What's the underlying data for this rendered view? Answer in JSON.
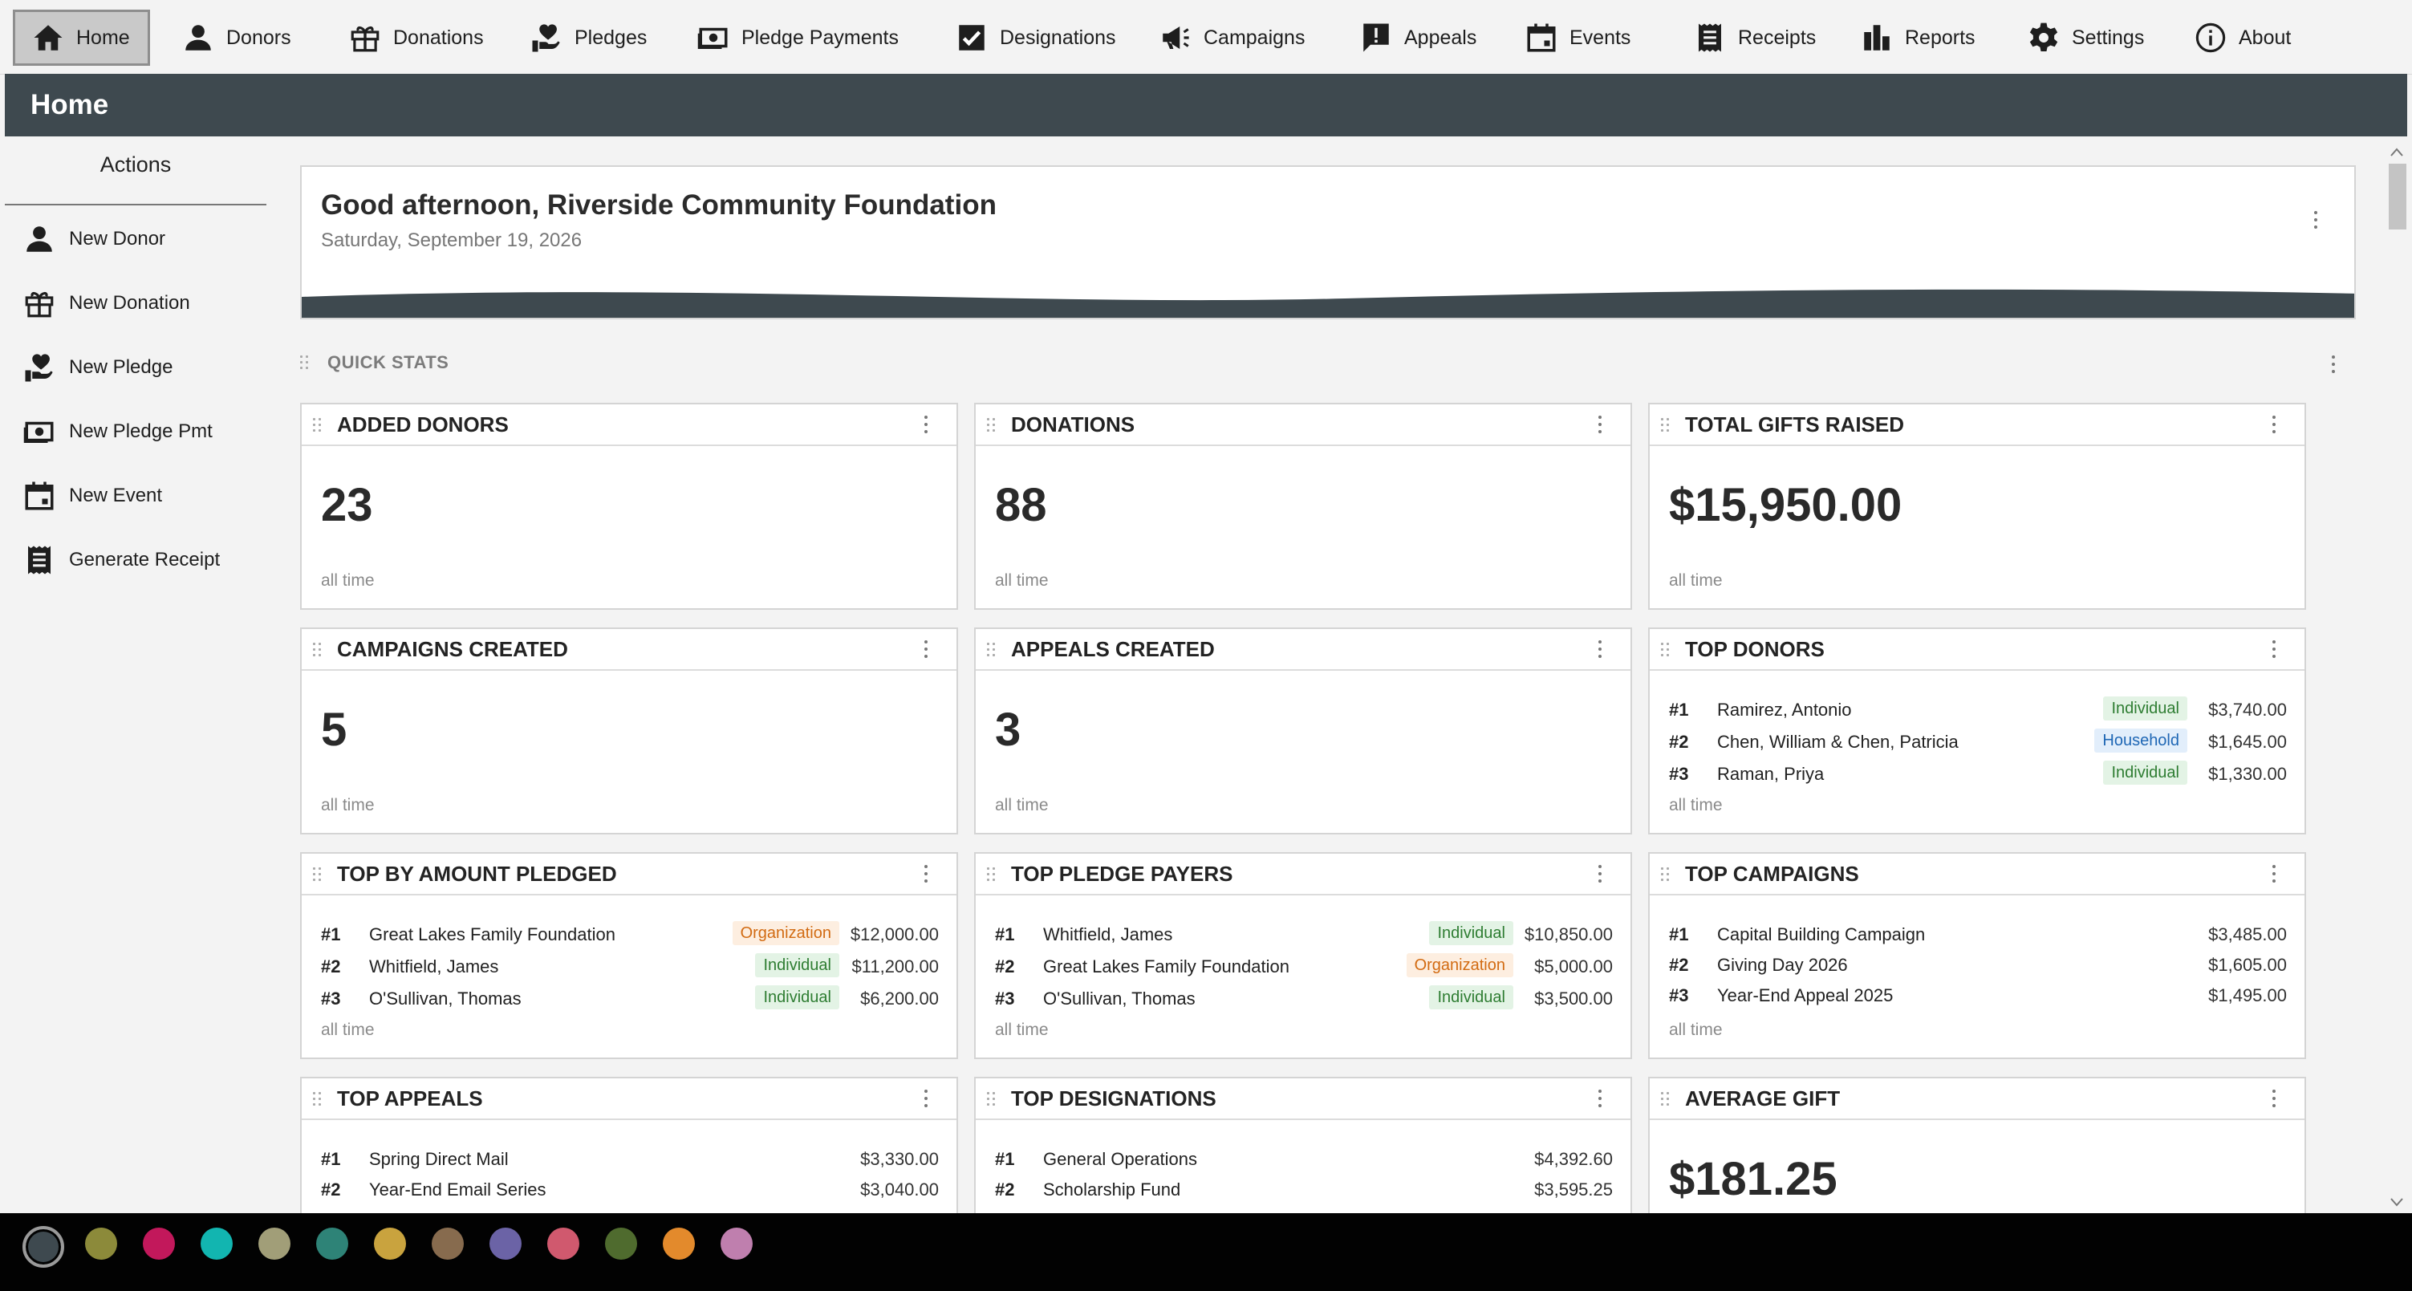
{
  "nav": {
    "items": [
      {
        "label": "Home",
        "icon": "home-icon"
      },
      {
        "label": "Donors",
        "icon": "person-icon"
      },
      {
        "label": "Donations",
        "icon": "gift-icon"
      },
      {
        "label": "Pledges",
        "icon": "hand-heart-icon"
      },
      {
        "label": "Pledge Payments",
        "icon": "cash-icon"
      },
      {
        "label": "Designations",
        "icon": "checkbox-icon"
      },
      {
        "label": "Campaigns",
        "icon": "megaphone-icon"
      },
      {
        "label": "Appeals",
        "icon": "alert-bubble-icon"
      },
      {
        "label": "Events",
        "icon": "calendar-icon"
      },
      {
        "label": "Receipts",
        "icon": "receipt-icon"
      },
      {
        "label": "Reports",
        "icon": "bar-chart-icon"
      },
      {
        "label": "Settings",
        "icon": "gear-icon"
      },
      {
        "label": "About",
        "icon": "info-icon"
      }
    ],
    "active": "Home"
  },
  "header": {
    "title": "Home"
  },
  "sidebar": {
    "title": "Actions",
    "items": [
      {
        "label": "New Donor",
        "icon": "person-icon"
      },
      {
        "label": "New Donation",
        "icon": "gift-icon"
      },
      {
        "label": "New Pledge",
        "icon": "hand-heart-icon"
      },
      {
        "label": "New Pledge Pmt",
        "icon": "cash-icon"
      },
      {
        "label": "New Event",
        "icon": "calendar-icon"
      },
      {
        "label": "Generate Receipt",
        "icon": "receipt-icon"
      }
    ]
  },
  "greeting": {
    "title": "Good afternoon, Riverside Community Foundation",
    "date": "Saturday, September 19, 2026"
  },
  "quick_stats": {
    "label": "QUICK STATS",
    "cards": {
      "added_donors": {
        "title": "ADDED DONORS",
        "value": "23",
        "sub": "all time"
      },
      "donations": {
        "title": "DONATIONS",
        "value": "88",
        "sub": "all time"
      },
      "total_gifts": {
        "title": "TOTAL GIFTS RAISED",
        "value": "$15,950.00",
        "sub": "all time"
      },
      "campaigns_created": {
        "title": "CAMPAIGNS CREATED",
        "value": "5",
        "sub": "all time"
      },
      "appeals_created": {
        "title": "APPEALS CREATED",
        "value": "3",
        "sub": "all time"
      },
      "top_donors": {
        "title": "TOP DONORS",
        "sub": "all time",
        "rows": [
          {
            "rank": "#1",
            "name": "Ramirez, Antonio",
            "badge": "Individual",
            "amount": "$3,740.00"
          },
          {
            "rank": "#2",
            "name": "Chen, William & Chen, Patricia",
            "badge": "Household",
            "amount": "$1,645.00"
          },
          {
            "rank": "#3",
            "name": "Raman, Priya",
            "badge": "Individual",
            "amount": "$1,330.00"
          }
        ]
      },
      "top_pledged": {
        "title": "TOP BY AMOUNT PLEDGED",
        "sub": "all time",
        "rows": [
          {
            "rank": "#1",
            "name": "Great Lakes Family Foundation",
            "badge": "Organization",
            "amount": "$12,000.00"
          },
          {
            "rank": "#2",
            "name": "Whitfield, James",
            "badge": "Individual",
            "amount": "$11,200.00"
          },
          {
            "rank": "#3",
            "name": "O'Sullivan, Thomas",
            "badge": "Individual",
            "amount": "$6,200.00"
          }
        ]
      },
      "top_pledge_payers": {
        "title": "TOP PLEDGE PAYERS",
        "sub": "all time",
        "rows": [
          {
            "rank": "#1",
            "name": "Whitfield, James",
            "badge": "Individual",
            "amount": "$10,850.00"
          },
          {
            "rank": "#2",
            "name": "Great Lakes Family Foundation",
            "badge": "Organization",
            "amount": "$5,000.00"
          },
          {
            "rank": "#3",
            "name": "O'Sullivan, Thomas",
            "badge": "Individual",
            "amount": "$3,500.00"
          }
        ]
      },
      "top_campaigns": {
        "title": "TOP CAMPAIGNS",
        "sub": "all time",
        "rows": [
          {
            "rank": "#1",
            "name": "Capital Building Campaign",
            "amount": "$3,485.00"
          },
          {
            "rank": "#2",
            "name": "Giving Day 2026",
            "amount": "$1,605.00"
          },
          {
            "rank": "#3",
            "name": "Year-End Appeal 2025",
            "amount": "$1,495.00"
          }
        ]
      },
      "top_appeals": {
        "title": "TOP APPEALS",
        "rows": [
          {
            "rank": "#1",
            "name": "Spring Direct Mail",
            "amount": "$3,330.00"
          },
          {
            "rank": "#2",
            "name": "Year-End Email Series",
            "amount": "$3,040.00"
          }
        ]
      },
      "top_designations": {
        "title": "TOP DESIGNATIONS",
        "rows": [
          {
            "rank": "#1",
            "name": "General Operations",
            "amount": "$4,392.60"
          },
          {
            "rank": "#2",
            "name": "Scholarship Fund",
            "amount": "$3,595.25"
          }
        ]
      },
      "average_gift": {
        "title": "AVERAGE GIFT",
        "value": "$181.25"
      }
    }
  },
  "theme_swatches": {
    "selected": "#3e494f",
    "colors": [
      "#3e494f",
      "#8c8a3a",
      "#c2185b",
      "#12b5b0",
      "#a19e78",
      "#2e8377",
      "#c9a33e",
      "#876b4e",
      "#6b63a6",
      "#d0596e",
      "#4f6b2e",
      "#e38a2c",
      "#bf7fae"
    ]
  },
  "colors": {
    "header_bg": "#3e494f",
    "badge_individual": "#2e7d32",
    "badge_household": "#1f67b5",
    "badge_organization": "#d26b12"
  }
}
